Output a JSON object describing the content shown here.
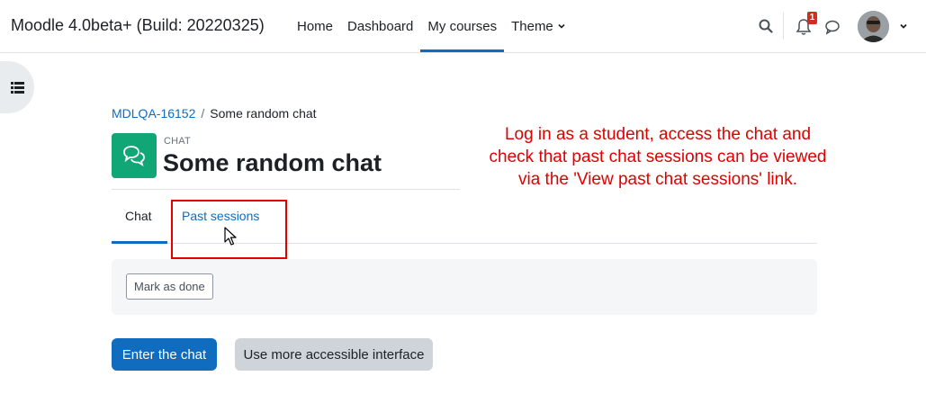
{
  "navbar": {
    "brand": "Moodle 4.0beta+ (Build: 20220325)",
    "items": [
      {
        "label": "Home"
      },
      {
        "label": "Dashboard"
      },
      {
        "label": "My courses"
      },
      {
        "label": "Theme"
      }
    ],
    "active_item": "My courses",
    "notification_count": "1"
  },
  "breadcrumb": {
    "course": "MDLQA-16152",
    "separator": "/",
    "current": "Some random chat"
  },
  "activity": {
    "type": "CHAT",
    "title": "Some random chat"
  },
  "annotation": {
    "line1": "Log in as a student, access the chat and",
    "line2": "check that past chat sessions can be viewed",
    "line3": "via the 'View past chat sessions' link."
  },
  "tabs": [
    {
      "label": "Chat"
    },
    {
      "label": "Past sessions"
    }
  ],
  "completion": {
    "mark_done_label": "Mark as done"
  },
  "actions": {
    "enter_label": "Enter the chat",
    "accessible_label": "Use more accessible interface"
  },
  "colors": {
    "primary": "#0f6cbf",
    "activity_icon_bg": "#11a676",
    "annotation": "#e00000",
    "badge": "#ca3120"
  }
}
